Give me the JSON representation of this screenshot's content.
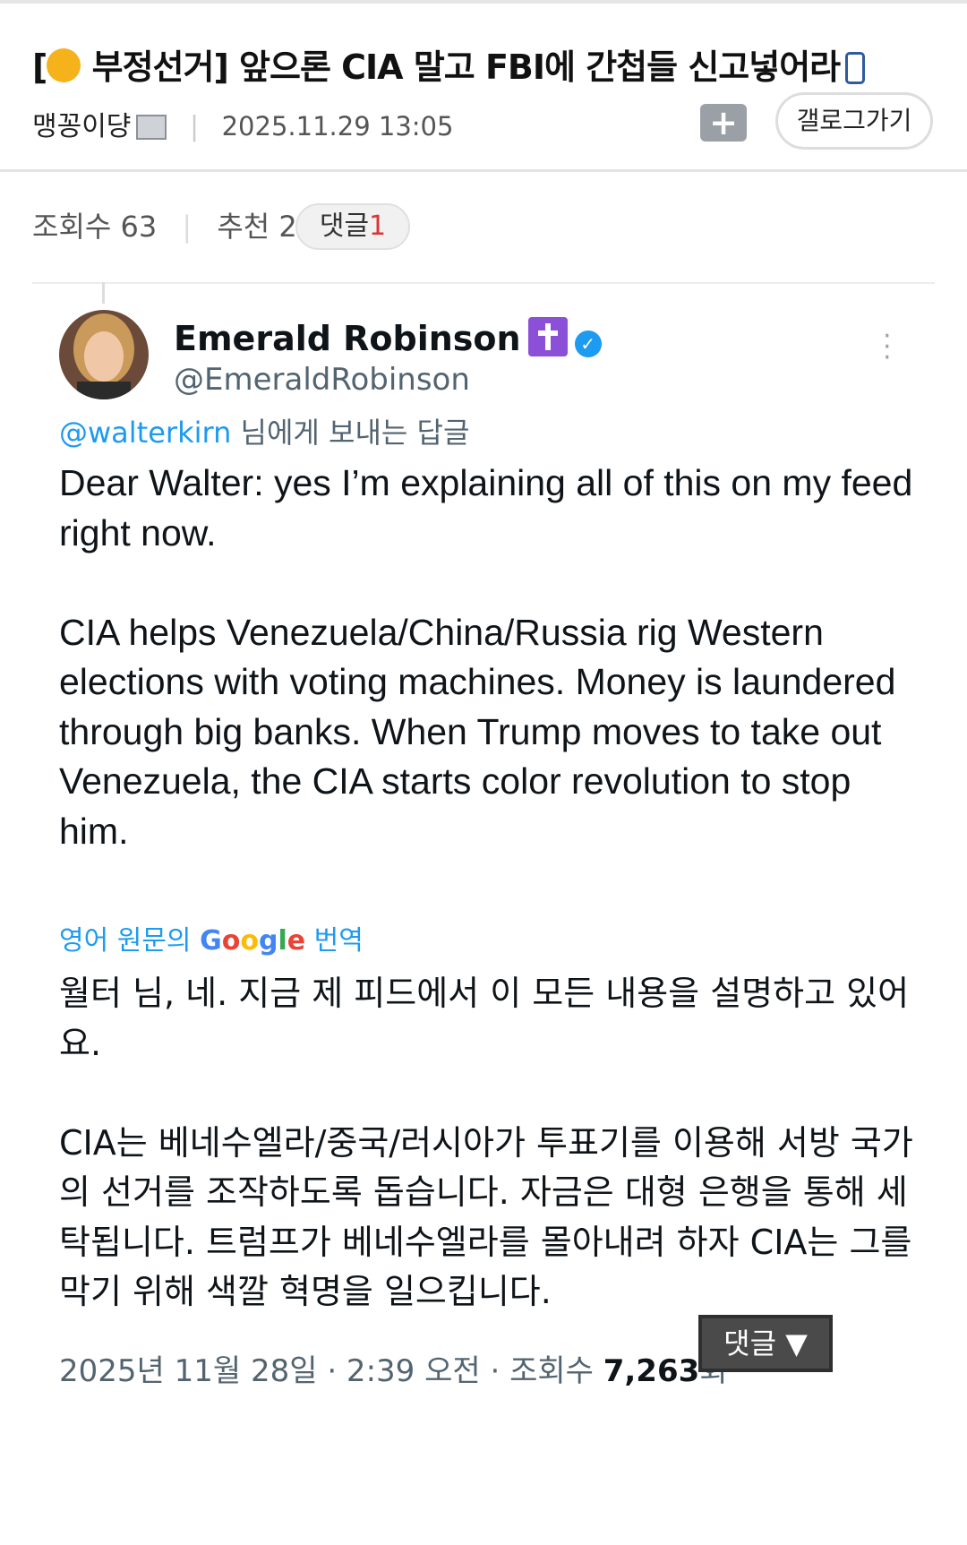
{
  "post": {
    "title_prefix": "[",
    "title_text": "부정선거] 앞으론 CIA 말고 FBI에 간첩들 신고넣어라",
    "author": "맹꽁이댱",
    "date": "2025.11.29 13:05",
    "gallery_button": "갤로그가기",
    "add_button": "+",
    "views_label": "조회수 63",
    "recommend_label": "추천 2",
    "comment_label": "댓글",
    "comment_count": "1"
  },
  "tweet": {
    "author_name": "Emerald Robinson",
    "handle": "@EmeraldRobinson",
    "reply_mention": "@walterkirn",
    "reply_suffix": " 님에게 보내는 답글",
    "text": "Dear Walter: yes I’m explaining all of this on my feed right now.\n\nCIA helps Venezuela/China/Russia rig Western elections with voting machines. Money is laundered through big banks. When Trump moves to take out Venezuela, the CIA starts color revolution to stop him.",
    "translate_prefix": "영어 원문의 ",
    "translate_google": "Google",
    "translate_suffix": " 번역",
    "translated_text": "월터 님, 네. 지금 제 피드에서 이 모든 내용을 설명하고 있어요.\n\nCIA는 베네수엘라/중국/러시아가 투표기를 이용해 서방 국가의 선거를 조작하도록 돕습니다. 자금은 대형 은행을 통해 세탁됩니다. 트럼프가 베네수엘라를 몰아내려 하자 CIA는 그를 막기 위해 색깔 혁명을 일으킵니다.",
    "timestamp": "2025년 11월 28일 · 2:39 오전 · 조회수 ",
    "views": "7,263",
    "views_suffix": "회"
  },
  "comment_toggle": "댓글 ▼",
  "colors": {
    "link_blue": "#1d9bf0",
    "badge_purple": "#8b4fd8",
    "count_red": "#dd3333"
  },
  "icons": [
    "fist-emoji-icon",
    "phone-icon",
    "nickname-badge-icon",
    "add-folder-icon",
    "cross-badge-icon",
    "verified-icon",
    "more-icon"
  ]
}
